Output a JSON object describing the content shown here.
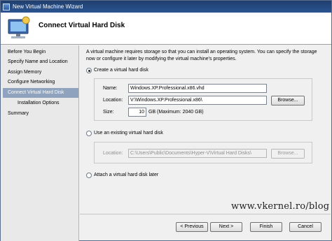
{
  "window": {
    "title": "New Virtual Machine Wizard"
  },
  "header": {
    "title": "Connect Virtual Hard Disk",
    "icon": "wizard-monitor-icon"
  },
  "nav": {
    "items": [
      {
        "label": "Before You Begin",
        "sub": false,
        "active": false
      },
      {
        "label": "Specify Name and Location",
        "sub": false,
        "active": false
      },
      {
        "label": "Assign Memory",
        "sub": false,
        "active": false
      },
      {
        "label": "Configure Networking",
        "sub": false,
        "active": false
      },
      {
        "label": "Connect Virtual Hard Disk",
        "sub": false,
        "active": true
      },
      {
        "label": "Installation Options",
        "sub": true,
        "active": false
      },
      {
        "label": "Summary",
        "sub": false,
        "active": false
      }
    ]
  },
  "content": {
    "description": "A virtual machine requires storage so that you can install an operating system. You can specify the storage now or configure it later by modifying the virtual machine's properties.",
    "option_create": {
      "label": "Create a virtual hard disk",
      "selected": true,
      "name_label": "Name:",
      "name_value": "Windows.XP.Professional.x86.vhd",
      "location_label": "Location:",
      "location_value": "V:\\Windows.XP.Professional.x86\\",
      "browse_label": "Browse...",
      "size_label": "Size:",
      "size_value": "10",
      "size_suffix": "GB (Maximum: 2040 GB)"
    },
    "option_existing": {
      "label": "Use an existing virtual hard disk",
      "selected": false,
      "location_label": "Location:",
      "location_value": "C:\\Users\\Public\\Documents\\Hyper-V\\Virtual Hard Disks\\",
      "browse_label": "Browse..."
    },
    "option_later": {
      "label": "Attach a virtual hard disk later",
      "selected": false
    }
  },
  "watermark": "www.vkernel.ro/blog",
  "buttons": {
    "previous": "< Previous",
    "next": "Next >",
    "finish": "Finish",
    "cancel": "Cancel"
  },
  "colors": {
    "title_bar": "#1f3e6e",
    "nav_active": "#8fa3bf",
    "nav_bg": "#e9e9e9"
  }
}
